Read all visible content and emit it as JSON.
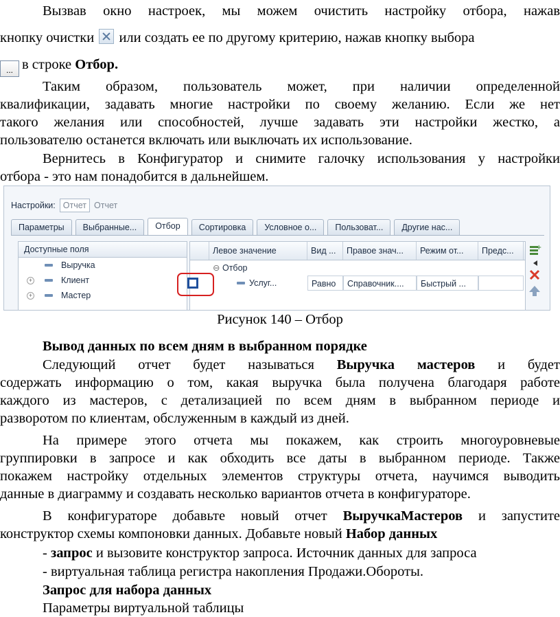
{
  "p1": {
    "l1": "Вызвав окно настроек, мы можем очистить настройку отбора, нажав",
    "l2a": "кнопку очистки",
    "l2b": "или создать ее по другому критерию, нажав кнопку выбора",
    "l3a": "в строке",
    "l3b": "Отбор."
  },
  "p2": [
    "Таким образом, пользователь может, при наличии определенной",
    "квалификации, задавать многие настройки по своему желанию. Если же нет",
    "такого желания или способностей, лучше задавать эти настройки жестко, а",
    "пользователю останется включать или выключать их использование."
  ],
  "p3": [
    "Вернитесь в Конфигуратор и снимите галочку использования у настройки",
    "отбора - это нам понадобится в дальнейшем."
  ],
  "shot": {
    "settings_label": "Настройки:",
    "settings_value": "Отчет",
    "settings_alt": "Отчет",
    "tabs": [
      "Параметры",
      "Выбранные...",
      "Отбор",
      "Сортировка",
      "Условное о...",
      "Пользоват...",
      "Другие нас..."
    ],
    "left_header": "Доступные поля",
    "fields": [
      "Выручка",
      "Клиент",
      "Мастер"
    ],
    "grid_headers": [
      "Левое значение",
      "Вид ...",
      "Правое знач...",
      "Режим от...",
      "Предс..."
    ],
    "group_row": "Отбор",
    "item_row": [
      "Услуг...",
      "Равно",
      "Справочник....",
      "Быстрый ..."
    ]
  },
  "caption": "Рисунок 140 – Отбор",
  "h1": "Вывод данных по всем дням в выбранном порядке",
  "p4": {
    "l1a": "Следующий отчет будет называться",
    "l1b": "Выручка мастеров",
    "l1c": "и будет",
    "l2": "содержать информацию о том, какая выручка была получена благодаря работе",
    "l3": "каждого из мастеров, с детализацией по всем дням в выбранном периоде и",
    "l4": "разворотом по клиентам, обслуженным в каждый из дней."
  },
  "p5": [
    "На примере этого отчета мы покажем, как строить многоуровневые",
    "группировки в запросе и как обходить все даты в выбранном периоде. Также",
    "покажем настройку отдельных элементов структуры отчета, научимся выводить",
    "данные в диаграмму и создавать несколько вариантов отчета в конфигураторе."
  ],
  "p6": {
    "l1a": "В конфигураторе добавьте новый отчет",
    "l1b": "ВыручкаМастеров",
    "l1c": "и запустите",
    "l2a": "конструктор схемы компоновки данных. Добавьте новый",
    "l2b": "Набор данных",
    "l3a": "-",
    "l3b": "запрос",
    "l3c": "и вызовите конструктор запроса. Источник данных для запроса",
    "l4": "- виртуальная таблица регистра накопления Продажи.Обороты."
  },
  "h2": "Запрос для набора данных",
  "p7": "Параметры виртуальной таблицы"
}
